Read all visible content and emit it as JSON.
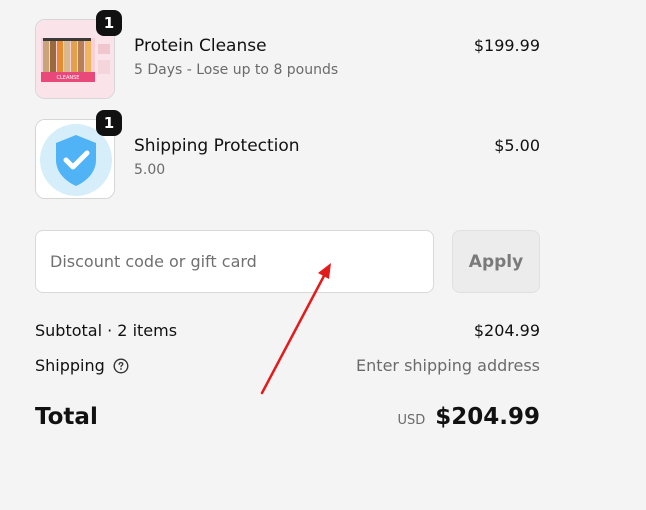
{
  "line_items": [
    {
      "quantity": "1",
      "title": "Protein Cleanse",
      "subtitle": "5 Days - Lose up to 8 pounds",
      "price": "$199.99",
      "image_label": "CLEANSE"
    },
    {
      "quantity": "1",
      "title": "Shipping Protection",
      "subtitle": "5.00",
      "price": "$5.00"
    }
  ],
  "discount": {
    "placeholder": "Discount code or gift card",
    "apply_label": "Apply"
  },
  "summary": {
    "subtotal_label": "Subtotal · 2 items",
    "subtotal_value": "$204.99",
    "shipping_label": "Shipping",
    "shipping_value": "Enter shipping address",
    "total_label": "Total",
    "currency": "USD",
    "total_value": "$204.99"
  },
  "colors": {
    "annotation_arrow": "#e31b1b",
    "shield": "#4fb3f5"
  },
  "icons": {
    "shipping_help": "question-circle-icon",
    "shipping_protection": "shield-check-icon"
  }
}
